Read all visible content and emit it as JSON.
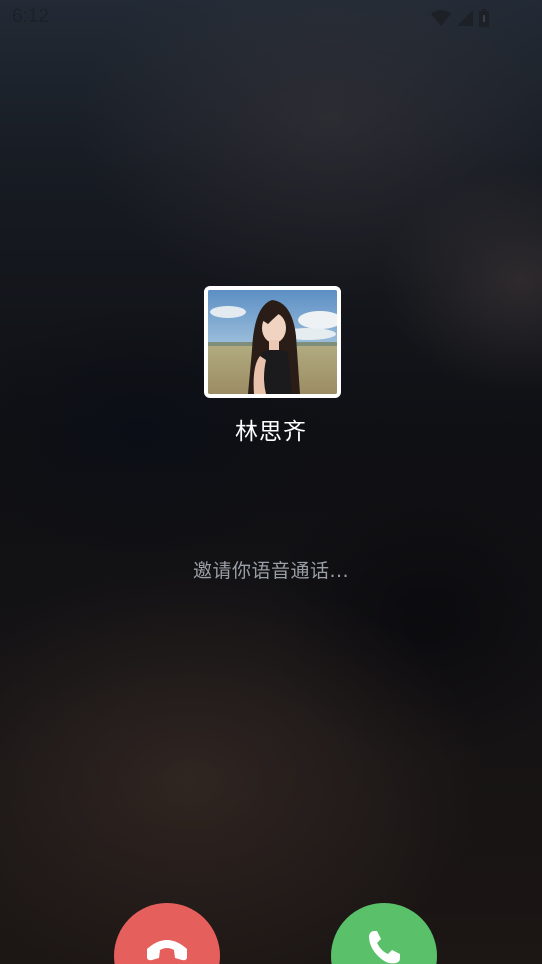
{
  "status_bar": {
    "time": "6:12",
    "icons": [
      "wifi-icon",
      "cell-signal-icon",
      "battery-icon"
    ]
  },
  "caller": {
    "name": "林思齐",
    "avatar_description": "avatar-photo"
  },
  "call": {
    "status_text": "邀请你语音通话..."
  },
  "actions": {
    "decline_icon": "hang-up-icon",
    "accept_icon": "phone-icon",
    "decline_color": "#e5605d",
    "accept_color": "#5ac16a"
  }
}
